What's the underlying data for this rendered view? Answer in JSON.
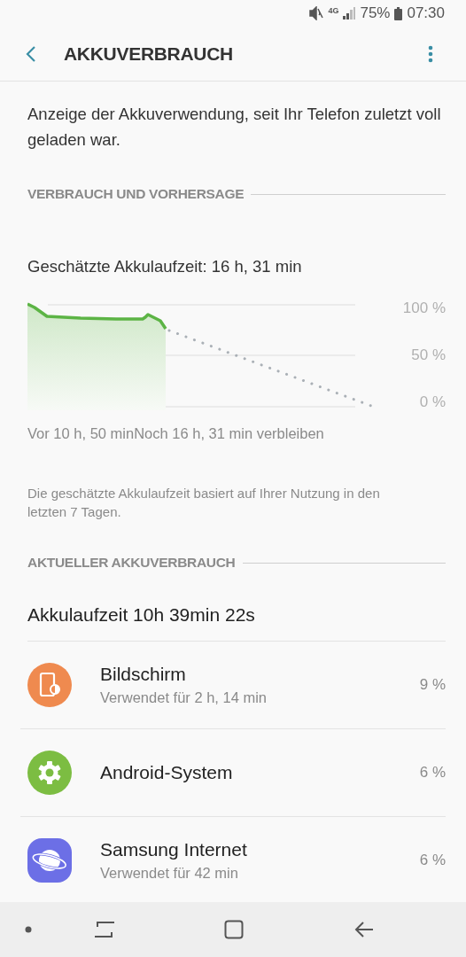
{
  "status_bar": {
    "network": "4G",
    "battery": "75%",
    "time": "07:30"
  },
  "header": {
    "title": "AKKUVERBRAUCH"
  },
  "description": "Anzeige der Akkuverwendung, seit Ihr Telefon zuletzt voll geladen war.",
  "usage_section": {
    "heading": "VERBRAUCH UND VORHERSAGE",
    "estimate": "Geschätzte Akkulaufzeit: 16 h, 31 min",
    "graph": {
      "y_labels": [
        "100 %",
        "50 %",
        "0 %"
      ],
      "past_label": "Vor 10 h, 50 min",
      "future_label": "Noch 16 h, 31 min verbleiben"
    },
    "note": "Die geschätzte Akkulaufzeit basiert auf Ihrer Nutzung in den letzten 7 Tagen."
  },
  "current_section": {
    "heading": "AKTUELLER AKKUVERBRAUCH",
    "runtime": "Akkulaufzeit 10h 39min 22s",
    "items": [
      {
        "kind": "screen",
        "name": "Bildschirm",
        "detail": "Verwendet für 2 h, 14 min",
        "percent": "9 %"
      },
      {
        "kind": "system",
        "name": "Android-System",
        "percent": "6 %"
      },
      {
        "kind": "internet",
        "name": "Samsung Internet",
        "detail": "Verwendet für 42 min",
        "percent": "6 %"
      }
    ]
  }
}
